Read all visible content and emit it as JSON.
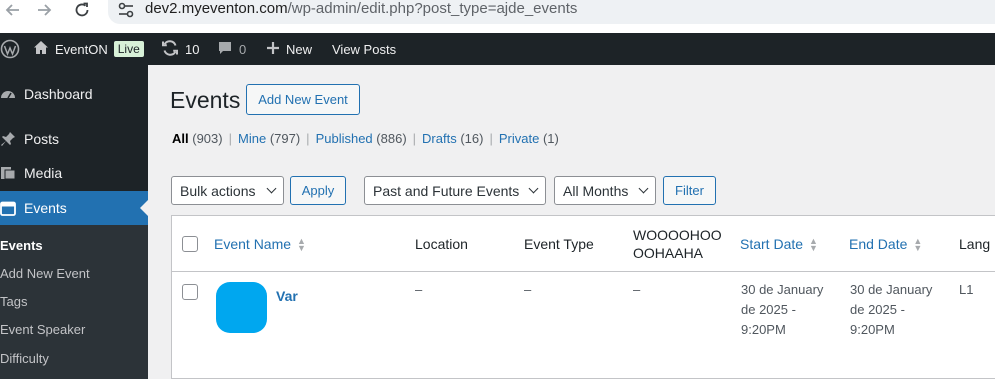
{
  "browser": {
    "url_host": "dev2.myeventon.com",
    "url_path": "/wp-admin/edit.php?post_type=ajde_events"
  },
  "admin_bar": {
    "site_name": "EventON",
    "live_badge": "Live",
    "updates_count": "10",
    "comments_count": "0",
    "new_label": "New",
    "view_posts_label": "View Posts"
  },
  "sidebar": {
    "items": [
      {
        "label": "Dashboard",
        "icon": "dashboard-icon"
      },
      {
        "label": "Posts",
        "icon": "pin-icon"
      },
      {
        "label": "Media",
        "icon": "media-icon"
      },
      {
        "label": "Events",
        "icon": "calendar-icon"
      }
    ],
    "submenu": [
      "Events",
      "Add New Event",
      "Tags",
      "Event Speaker",
      "Difficulty"
    ]
  },
  "page": {
    "title": "Events",
    "add_new_label": "Add New Event"
  },
  "views": {
    "all_label": "All",
    "all_count": "(903)",
    "mine_label": "Mine",
    "mine_count": "(797)",
    "published_label": "Published",
    "published_count": "(886)",
    "drafts_label": "Drafts",
    "drafts_count": "(16)",
    "private_label": "Private",
    "private_count": "(1)",
    "separator": "|"
  },
  "filters": {
    "bulk_actions": "Bulk actions",
    "apply_label": "Apply",
    "range_value": "Past and Future Events",
    "months_value": "All Months",
    "filter_label": "Filter"
  },
  "table": {
    "columns": {
      "name": "Event Name",
      "location": "Location",
      "type": "Event Type",
      "custom": "WOOOOHOO OOHAAHA",
      "start": "Start Date",
      "end": "End Date",
      "lang": "Lang"
    },
    "rows": [
      {
        "name": "Var",
        "location": "–",
        "type": "–",
        "custom": "–",
        "start": "30 de January de 2025 - 9:20PM",
        "end": "30 de January de 2025 - 9:20PM",
        "lang": "L1"
      }
    ]
  },
  "colors": {
    "accent": "#2271b1",
    "admin_bg": "#1d2327",
    "thumb": "#00a7ef"
  }
}
